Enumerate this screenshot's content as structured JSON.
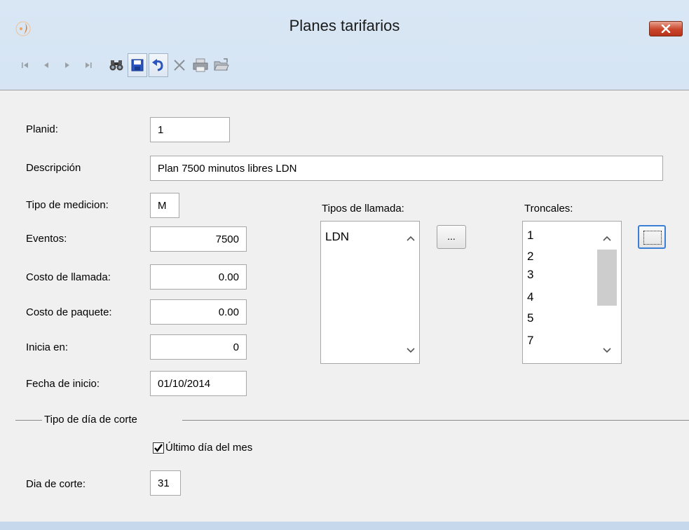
{
  "window": {
    "title": "Planes tarifarios"
  },
  "toolbar": {
    "icons": [
      "first-record-icon",
      "previous-record-icon",
      "next-record-icon",
      "last-record-icon",
      "binoculars-icon",
      "save-icon",
      "undo-icon",
      "delete-icon",
      "print-icon",
      "open-folder-icon"
    ]
  },
  "form": {
    "planid": {
      "label": "Planid:",
      "value": "1"
    },
    "descripcion": {
      "label": "Descripción",
      "value": "Plan 7500 minutos libres LDN"
    },
    "tipo_medicion": {
      "label": "Tipo de medicion:",
      "value": "M"
    },
    "eventos": {
      "label": "Eventos:",
      "value": "7500"
    },
    "costo_llamada": {
      "label": "Costo de llamada:",
      "value": "0.00"
    },
    "costo_paquete": {
      "label": "Costo de paquete:",
      "value": "0.00"
    },
    "inicia_en": {
      "label": "Inicia en:",
      "value": "0"
    },
    "fecha_inicio": {
      "label": "Fecha de inicio:",
      "value": "01/10/2014"
    }
  },
  "tipos_llamada": {
    "label": "Tipos de llamada:",
    "items": [
      "LDN"
    ],
    "button_label": "..."
  },
  "troncales": {
    "label": "Troncales:",
    "items": [
      "1",
      "2",
      "3",
      "4",
      "5",
      "7"
    ]
  },
  "corte": {
    "group_label": "Tipo de día de corte",
    "ultimo_dia": {
      "label": "Último día del mes",
      "checked": true
    },
    "dia_corte": {
      "label": "Dia de corte:",
      "value": "31"
    }
  }
}
